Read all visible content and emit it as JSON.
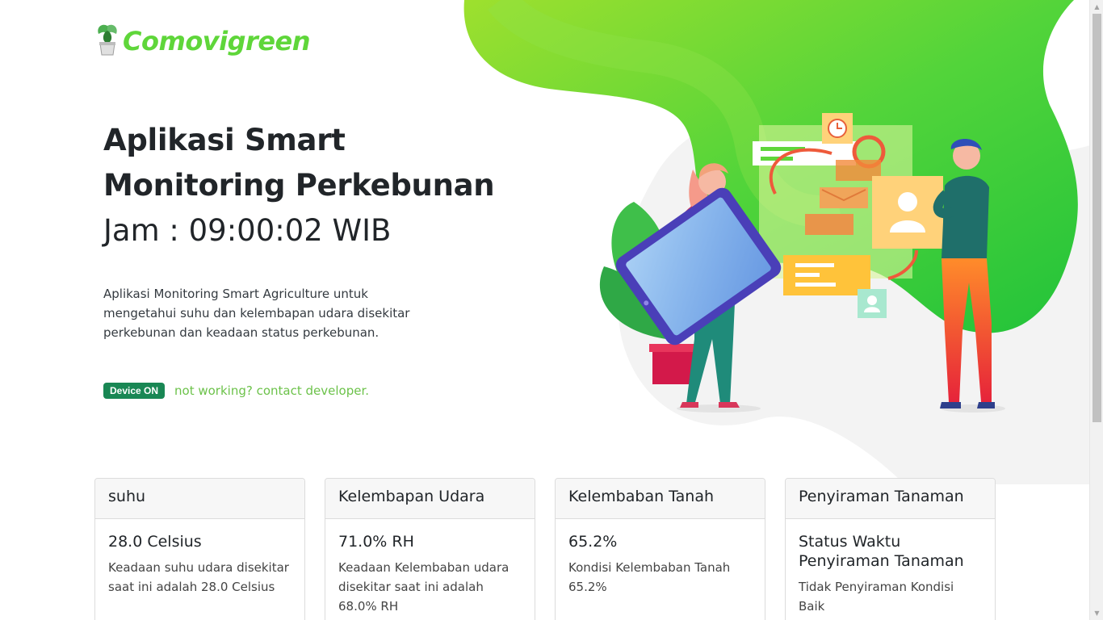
{
  "brand": {
    "name": "Comovigreen",
    "logo_icon": "potted-plant-icon"
  },
  "hero": {
    "title_line1": "Aplikasi Smart",
    "title_line2": "Monitoring Perkebunan",
    "clock": "Jam : 09:00:02 WIB",
    "description": "Aplikasi Monitoring Smart Agriculture untuk mengetahui suhu dan kelembapan udara disekitar perkebunan dan keadaan status perkebunan.",
    "status_badge": "Device ON",
    "contact_link": "not working? contact developer."
  },
  "cards": [
    {
      "header": "suhu",
      "title": "28.0 Celsius",
      "text": "Keadaan suhu udara disekitar saat ini adalah 28.0 Celsius"
    },
    {
      "header": "Kelembapan Udara",
      "title": "71.0% RH",
      "text": "Keadaan Kelembaban udara disekitar saat ini adalah 68.0% RH"
    },
    {
      "header": "Kelembaban Tanah",
      "title": "65.2%",
      "text": "Kondisi Kelembaban Tanah 65.2%"
    },
    {
      "header": "Penyiraman Tanaman",
      "title": "Status Waktu Penyiraman Tanaman",
      "text": "Tidak Penyiraman Kondisi Baik"
    }
  ],
  "colors": {
    "brand_green": "#5fd63a",
    "badge_green": "#198754",
    "link_green": "#6cc24a"
  }
}
